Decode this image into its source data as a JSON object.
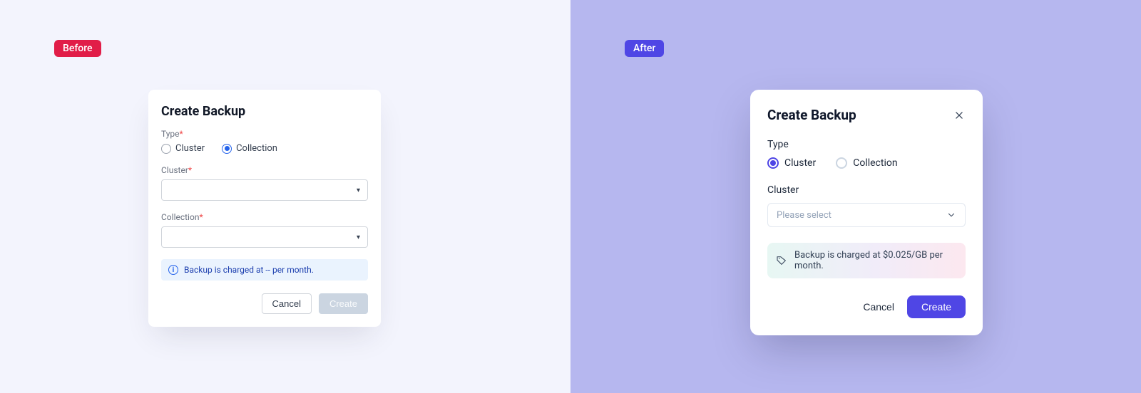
{
  "badges": {
    "before": "Before",
    "after": "After"
  },
  "before": {
    "title": "Create Backup",
    "type_label": "Type",
    "asterisk": "*",
    "radios": {
      "cluster": "Cluster",
      "collection": "Collection"
    },
    "cluster_label": "Cluster",
    "collection_label": "Collection",
    "notice": "Backup is charged at -- per month.",
    "actions": {
      "cancel": "Cancel",
      "create": "Create"
    }
  },
  "after": {
    "title": "Create Backup",
    "type_label": "Type",
    "radios": {
      "cluster": "Cluster",
      "collection": "Collection"
    },
    "cluster_label": "Cluster",
    "select_placeholder": "Please select",
    "notice": "Backup is charged at $0.025/GB per month.",
    "actions": {
      "cancel": "Cancel",
      "create": "Create"
    }
  }
}
